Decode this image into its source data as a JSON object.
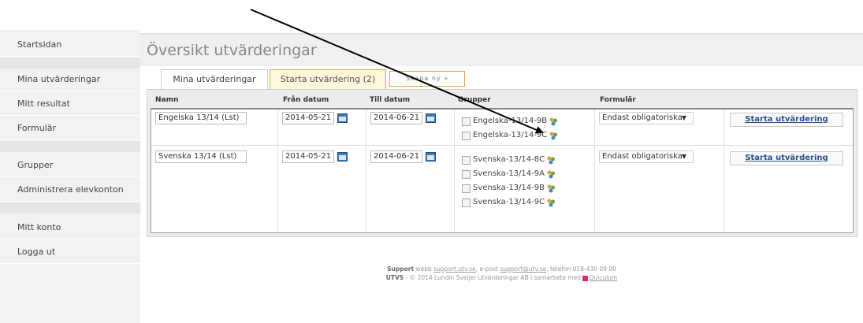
{
  "sidebar": {
    "items": [
      {
        "label": "Startsidan"
      },
      {
        "label": "Mina utvärderingar"
      },
      {
        "label": "Mitt resultat"
      },
      {
        "label": "Formulär"
      },
      {
        "label": "Grupper"
      },
      {
        "label": "Administrera elevkonton"
      },
      {
        "label": "Mitt konto"
      },
      {
        "label": "Logga ut"
      }
    ]
  },
  "main": {
    "title": "Översikt utvärderingar",
    "tabs": [
      {
        "label": "Mina utvärderingar"
      },
      {
        "label": "Starta utvärdering (2)"
      },
      {
        "label": "Skapa ny »"
      }
    ]
  },
  "table": {
    "headers": [
      "Namn",
      "Från datum",
      "Till datum",
      "Grupper",
      "Formulär",
      ""
    ],
    "rows": [
      {
        "name": "Engelska 13/14 (Lst)",
        "from": "2014-05-21",
        "to": "2014-06-21",
        "groups": [
          "Engelska-13/14-9B",
          "Engelska-13/14-9C"
        ],
        "form": "Endast obligatoriska",
        "button": "Starta utvärdering"
      },
      {
        "name": "Svenska 13/14 (Lst)",
        "from": "2014-05-21",
        "to": "2014-06-21",
        "groups": [
          "Svenska-13/14-8C",
          "Svenska-13/14-9A",
          "Svenska-13/14-9B",
          "Svenska-13/14-9C"
        ],
        "form": "Endast obligatoriska",
        "button": "Starta utvärdering"
      }
    ]
  },
  "footer": {
    "support_label": "Support",
    "support_text_1": "webb",
    "support_web": "support.utv.se",
    "support_text_2": ", e-post",
    "support_email": "support@utv.se",
    "support_text_3": ", telefon 018-430 09 00",
    "utvs_label": "UTVS",
    "utvs_text": "- © 2014 Lundin Sveijer utvärderingar AB i samarbete med",
    "partner": "Quiculum"
  },
  "icons": {
    "calendar": "calendar-icon",
    "group": "group-icon",
    "dropdown": "chevron-down-icon"
  },
  "colors": {
    "tab_active_border": "#e0a84b",
    "link": "#2a4f8a",
    "calendar": "#3a78b6"
  }
}
